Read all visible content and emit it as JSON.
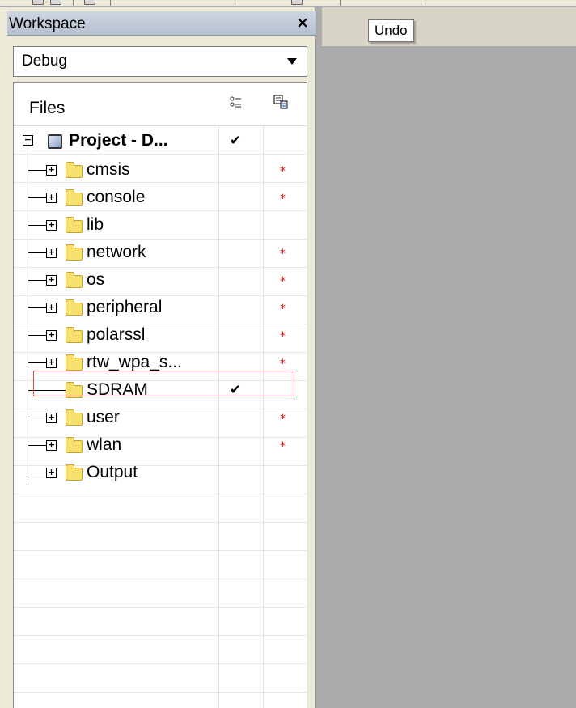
{
  "workspace": {
    "title": "Workspace",
    "close_label": "×",
    "configuration": "Debug"
  },
  "grid": {
    "header_files": "Files"
  },
  "project": {
    "label": "Project - D...",
    "checked": "✔"
  },
  "folders": [
    {
      "label": "cmsis",
      "star": "*"
    },
    {
      "label": "console",
      "star": "*"
    },
    {
      "label": "lib",
      "star": ""
    },
    {
      "label": "network",
      "star": "*"
    },
    {
      "label": "os",
      "star": "*"
    },
    {
      "label": "peripheral",
      "star": "*"
    },
    {
      "label": "polarssl",
      "star": "*"
    },
    {
      "label": "rtw_wpa_s...",
      "star": "*"
    },
    {
      "label": "SDRAM",
      "star": "",
      "check": "✔"
    },
    {
      "label": "user",
      "star": "*"
    },
    {
      "label": "wlan",
      "star": "*"
    },
    {
      "label": "Output",
      "star": ""
    }
  ],
  "tooltip": {
    "text": "Undo"
  }
}
